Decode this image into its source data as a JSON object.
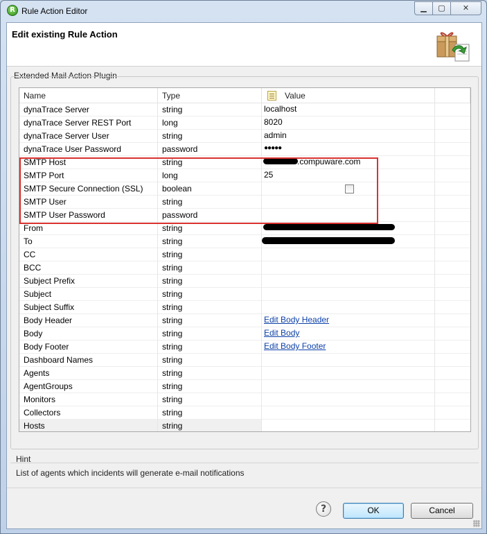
{
  "window": {
    "title": "Rule Action Editor",
    "icon": "app-logo-icon",
    "controls": [
      "minimize-icon",
      "maximize-icon",
      "close-icon"
    ]
  },
  "header": {
    "title": "Edit existing Rule Action",
    "icon": "gift-box-icon"
  },
  "group": {
    "label": "Extended Mail Action Plugin"
  },
  "table": {
    "columns": {
      "name": "Name",
      "type": "Type",
      "value": "Value"
    },
    "rows": [
      {
        "name": "dynaTrace Server",
        "type": "string",
        "value": "localhost"
      },
      {
        "name": "dynaTrace Server REST Port",
        "type": "long",
        "value": "8020"
      },
      {
        "name": "dynaTrace Server User",
        "type": "string",
        "value": "admin"
      },
      {
        "name": "dynaTrace User Password",
        "type": "password",
        "value": "●●●●●"
      },
      {
        "name": "SMTP Host",
        "type": "string",
        "value": ".compuware.com"
      },
      {
        "name": "SMTP Port",
        "type": "long",
        "value": "25"
      },
      {
        "name": "SMTP Secure Connection (SSL)",
        "type": "boolean",
        "value": ""
      },
      {
        "name": "SMTP User",
        "type": "string",
        "value": ""
      },
      {
        "name": "SMTP User Password",
        "type": "password",
        "value": ""
      },
      {
        "name": "From",
        "type": "string",
        "value": ""
      },
      {
        "name": "To",
        "type": "string",
        "value": ""
      },
      {
        "name": "CC",
        "type": "string",
        "value": ""
      },
      {
        "name": "BCC",
        "type": "string",
        "value": ""
      },
      {
        "name": "Subject Prefix",
        "type": "string",
        "value": ""
      },
      {
        "name": "Subject",
        "type": "string",
        "value": ""
      },
      {
        "name": "Subject Suffix",
        "type": "string",
        "value": ""
      },
      {
        "name": "Body Header",
        "type": "string",
        "value": "Edit Body Header"
      },
      {
        "name": "Body",
        "type": "string",
        "value": "Edit Body"
      },
      {
        "name": "Body Footer",
        "type": "string",
        "value": "Edit Body Footer"
      },
      {
        "name": "Dashboard Names",
        "type": "string",
        "value": ""
      },
      {
        "name": "Agents",
        "type": "string",
        "value": ""
      },
      {
        "name": "AgentGroups",
        "type": "string",
        "value": ""
      },
      {
        "name": "Monitors",
        "type": "string",
        "value": ""
      },
      {
        "name": "Collectors",
        "type": "string",
        "value": ""
      },
      {
        "name": "Hosts",
        "type": "string",
        "value": ""
      }
    ]
  },
  "hint": {
    "label": "Hint",
    "text": "List of agents which incidents will generate e-mail notifications"
  },
  "buttons": {
    "help": "?",
    "ok": "OK",
    "cancel": "Cancel"
  },
  "colors": {
    "highlight_border": "#d9312f",
    "link": "#0b3fa8"
  }
}
